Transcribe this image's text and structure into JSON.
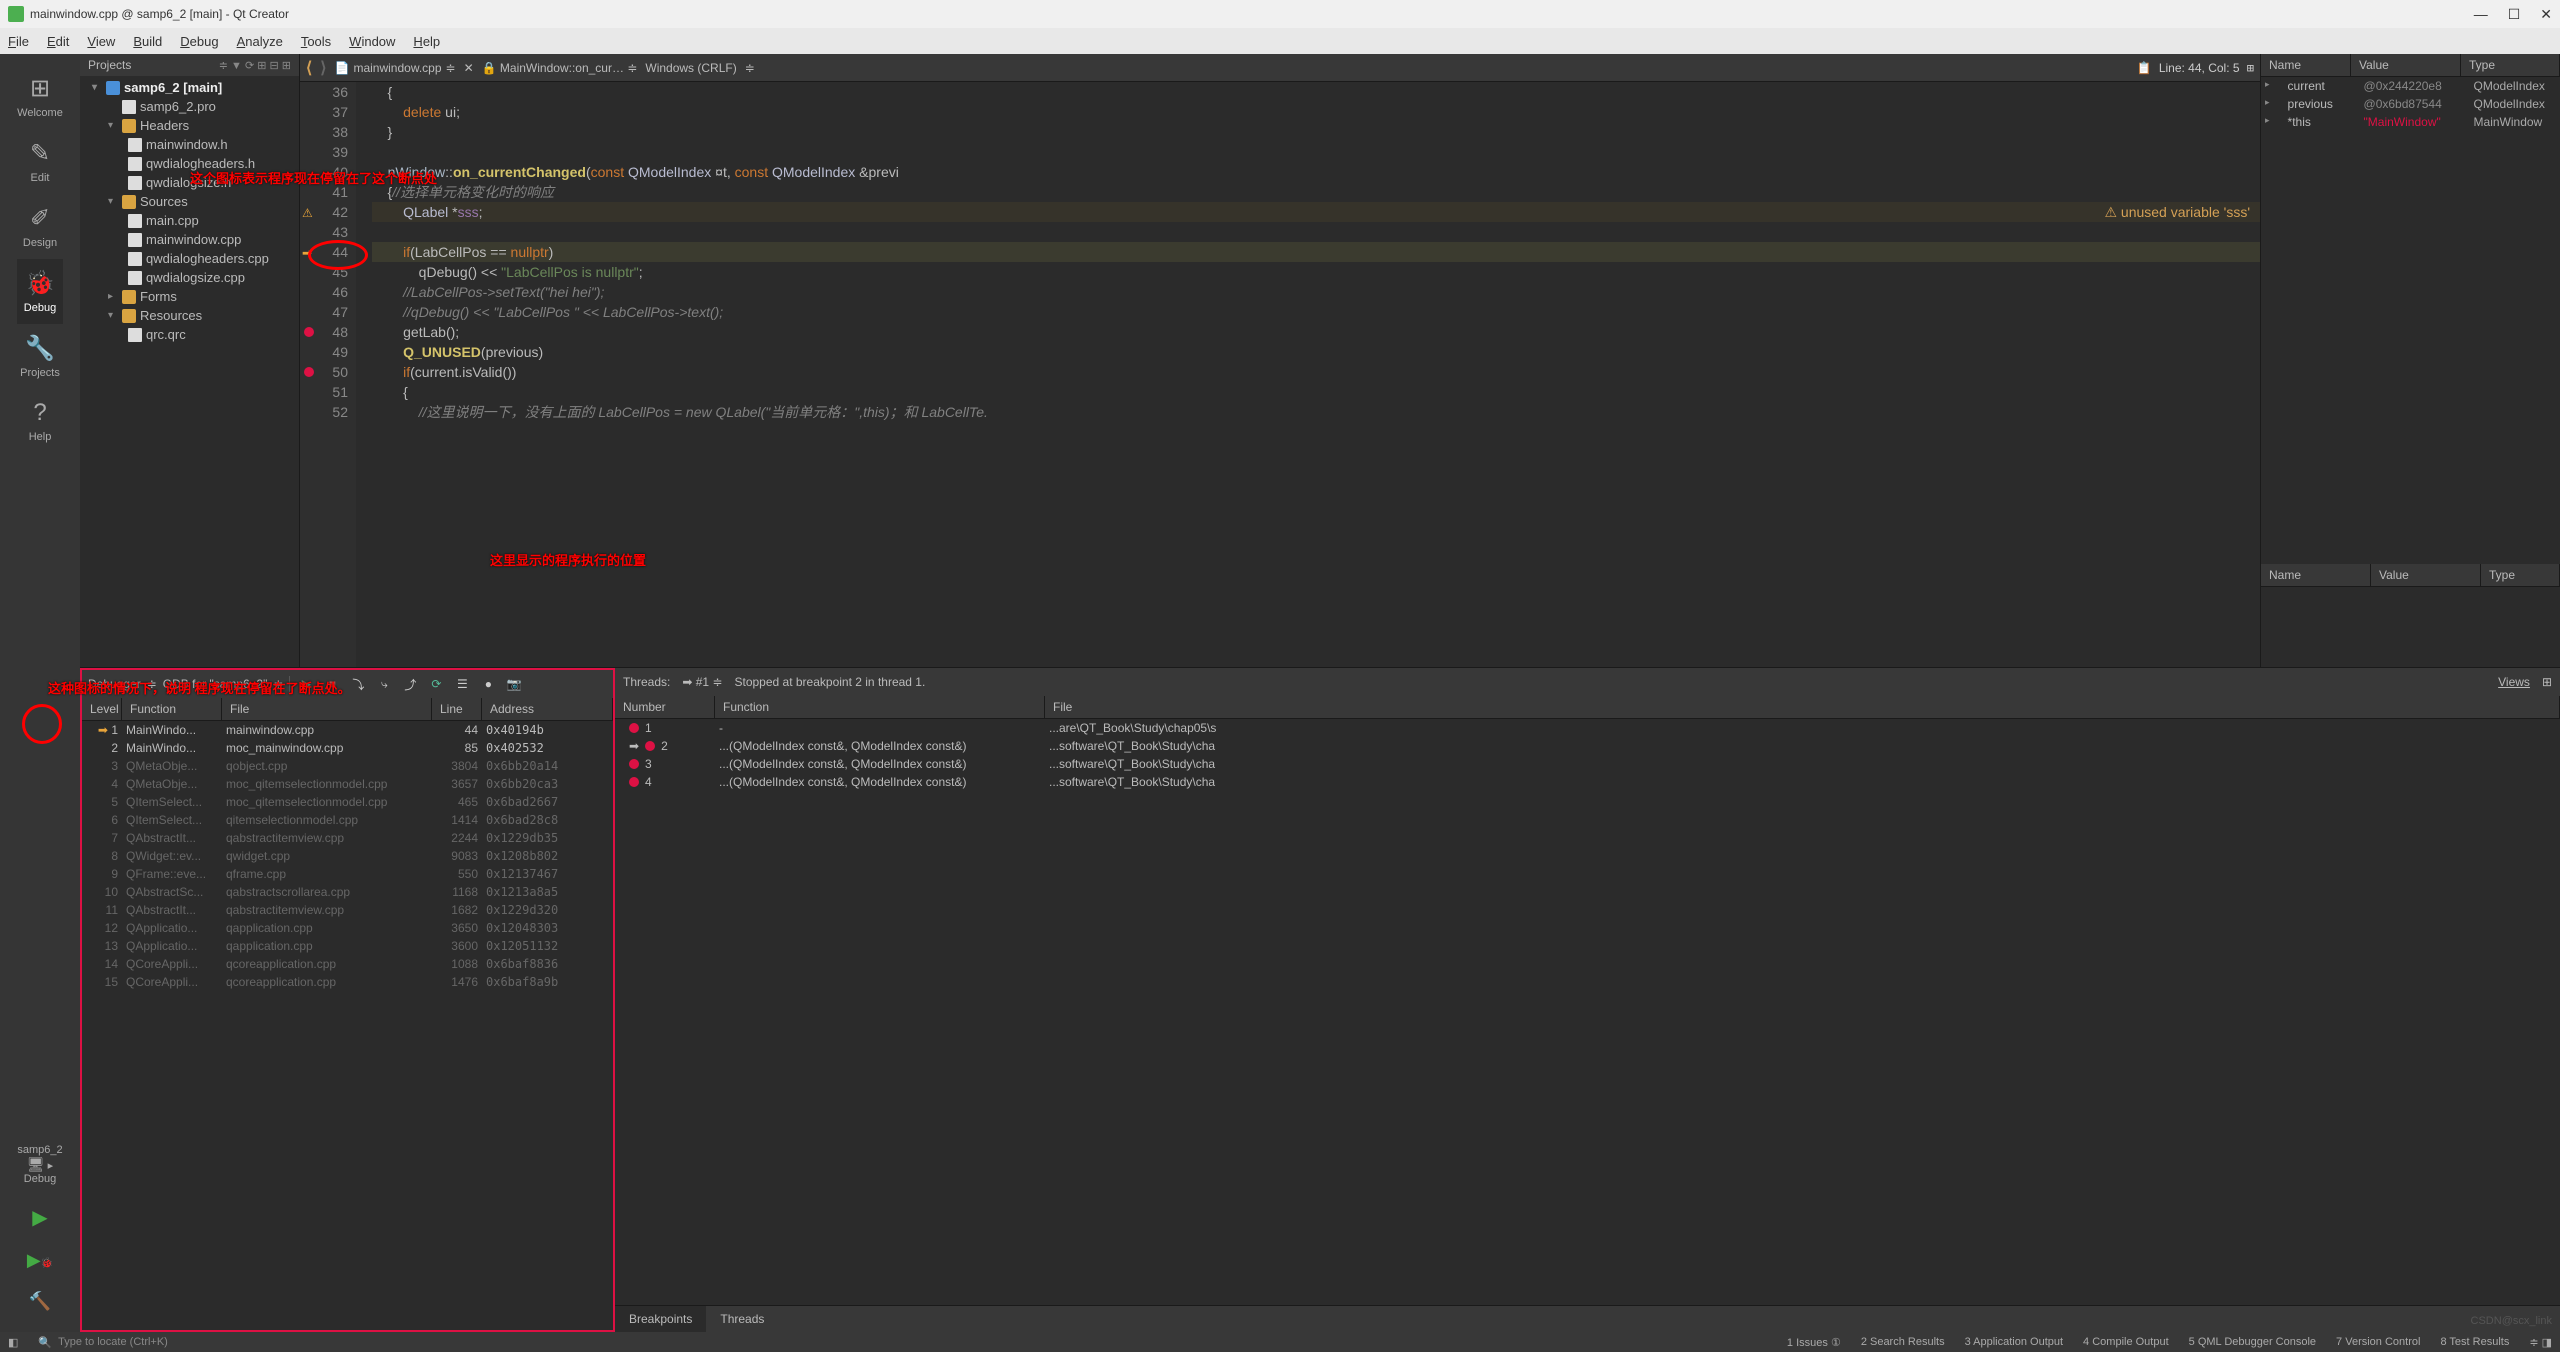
{
  "window": {
    "title": "mainwindow.cpp @ samp6_2 [main] - Qt Creator"
  },
  "menu": [
    "File",
    "Edit",
    "View",
    "Build",
    "Debug",
    "Analyze",
    "Tools",
    "Window",
    "Help"
  ],
  "modes": [
    {
      "label": "Welcome",
      "icon": "⊞"
    },
    {
      "label": "Edit",
      "icon": "✎"
    },
    {
      "label": "Design",
      "icon": "✐"
    },
    {
      "label": "Debug",
      "icon": "🐞",
      "active": true
    },
    {
      "label": "Projects",
      "icon": "🔧"
    },
    {
      "label": "Help",
      "icon": "?"
    }
  ],
  "target": {
    "name": "samp6_2",
    "config": "Debug"
  },
  "projects_title": "Projects",
  "tree": {
    "root": "samp6_2 [main]",
    "pro": "samp6_2.pro",
    "headers": "Headers",
    "h1": "mainwindow.h",
    "h2": "qwdialogheaders.h",
    "h3": "qwdialogsize.h",
    "sources": "Sources",
    "s1": "main.cpp",
    "s2": "mainwindow.cpp",
    "s3": "qwdialogheaders.cpp",
    "s4": "qwdialogsize.cpp",
    "forms": "Forms",
    "resources": "Resources",
    "qrc": "qrc.qrc"
  },
  "editor": {
    "file": "mainwindow.cpp",
    "symbol": "MainWindow::on_cur…",
    "encoding": "Windows (CRLF)",
    "position": "Line: 44, Col: 5",
    "lines": [
      {
        "n": 36,
        "code": "    {"
      },
      {
        "n": 37,
        "code": "        delete ui;",
        "parts": [
          [
            "        ",
            ""
          ],
          [
            "delete",
            "kw"
          ],
          [
            " ui;",
            ""
          ]
        ]
      },
      {
        "n": 38,
        "code": "    }"
      },
      {
        "n": 39,
        "code": ""
      },
      {
        "n": 40,
        "parts": [
          [
            "    ",
            ""
          ],
          [
            "nWindow",
            "cls"
          ],
          [
            "::",
            ""
          ],
          [
            "on_currentChanged",
            "fn"
          ],
          [
            "(",
            ""
          ],
          [
            "const",
            "kw"
          ],
          [
            " ",
            ""
          ],
          [
            "QModelIndex",
            "type"
          ],
          [
            " &current, ",
            ""
          ],
          [
            "const",
            "kw"
          ],
          [
            " ",
            ""
          ],
          [
            "QModelIndex",
            "type"
          ],
          [
            " &previ",
            ""
          ]
        ]
      },
      {
        "n": 41,
        "parts": [
          [
            "    {",
            ""
          ],
          [
            "//选择单元格变化时的响应",
            "cmt"
          ]
        ]
      },
      {
        "n": 42,
        "bp": "warn",
        "warn": "unused variable 'sss'",
        "cls": "warn-line",
        "parts": [
          [
            "        ",
            ""
          ],
          [
            "QLabel",
            "type"
          ],
          [
            " *",
            ""
          ],
          [
            "sss",
            "ptr"
          ],
          [
            ";",
            ""
          ]
        ]
      },
      {
        "n": 43,
        "code": ""
      },
      {
        "n": 44,
        "bp": "arrow",
        "cls": "cur-line",
        "parts": [
          [
            "        ",
            ""
          ],
          [
            "if",
            "kw"
          ],
          [
            "(LabCellPos == ",
            ""
          ],
          [
            "nullptr",
            "kw"
          ],
          [
            ")",
            ""
          ]
        ]
      },
      {
        "n": 45,
        "parts": [
          [
            "            qDebug() << ",
            ""
          ],
          [
            "\"LabCellPos is nullptr\"",
            "str"
          ],
          [
            ";",
            ""
          ]
        ]
      },
      {
        "n": 46,
        "parts": [
          [
            "        ",
            ""
          ],
          [
            "//LabCellPos->setText(\"hei hei\");",
            "cmt"
          ]
        ]
      },
      {
        "n": 47,
        "parts": [
          [
            "        ",
            ""
          ],
          [
            "//qDebug() << \"LabCellPos \" << LabCellPos->text();",
            "cmt"
          ]
        ]
      },
      {
        "n": 48,
        "bp": "red",
        "parts": [
          [
            "        getLab();",
            ""
          ]
        ]
      },
      {
        "n": 49,
        "parts": [
          [
            "        ",
            ""
          ],
          [
            "Q_UNUSED",
            "fn"
          ],
          [
            "(previous)",
            ""
          ]
        ]
      },
      {
        "n": 50,
        "bp": "red",
        "parts": [
          [
            "        ",
            ""
          ],
          [
            "if",
            "kw"
          ],
          [
            "(current.isValid())",
            ""
          ]
        ]
      },
      {
        "n": 51,
        "code": "        {"
      },
      {
        "n": 52,
        "parts": [
          [
            "            ",
            ""
          ],
          [
            "//这里说明一下，没有上面的 LabCellPos = new QLabel(\"当前单元格：\",this)；和 LabCellTe.",
            "cmt"
          ]
        ]
      }
    ]
  },
  "locals": {
    "headers": [
      "Name",
      "Value",
      "Type"
    ],
    "rows": [
      {
        "name": "current",
        "value": "@0x244220e8",
        "type": "QModelIndex"
      },
      {
        "name": "previous",
        "value": "@0x6bd87544",
        "type": "QModelIndex"
      },
      {
        "name": "*this",
        "value": "\"MainWindow\"",
        "type": "MainWindow",
        "red": true
      }
    ]
  },
  "debugger": {
    "label": "Debugger",
    "target": "GDB for \"samp6_2\"",
    "stack_headers": [
      "Level",
      "Function",
      "File",
      "Line",
      "Address"
    ],
    "stack": [
      {
        "lv": "1",
        "fn": "MainWindo...",
        "fl": "mainwindow.cpp",
        "ln": "44",
        "ad": "0x40194b",
        "cur": true
      },
      {
        "lv": "2",
        "fn": "MainWindo...",
        "fl": "moc_mainwindow.cpp",
        "ln": "85",
        "ad": "0x402532"
      },
      {
        "lv": "3",
        "fn": "QMetaObje...",
        "fl": "qobject.cpp",
        "ln": "3804",
        "ad": "0x6bb20a14",
        "dim": true
      },
      {
        "lv": "4",
        "fn": "QMetaObje...",
        "fl": "moc_qitemselectionmodel.cpp",
        "ln": "3657",
        "ad": "0x6bb20ca3",
        "dim": true
      },
      {
        "lv": "5",
        "fn": "QItemSelect...",
        "fl": "moc_qitemselectionmodel.cpp",
        "ln": "465",
        "ad": "0x6bad2667",
        "dim": true
      },
      {
        "lv": "6",
        "fn": "QItemSelect...",
        "fl": "qitemselectionmodel.cpp",
        "ln": "1414",
        "ad": "0x6bad28c8",
        "dim": true
      },
      {
        "lv": "7",
        "fn": "QAbstractIt...",
        "fl": "qabstractitemview.cpp",
        "ln": "2244",
        "ad": "0x1229db35",
        "dim": true
      },
      {
        "lv": "8",
        "fn": "QWidget::ev...",
        "fl": "qwidget.cpp",
        "ln": "9083",
        "ad": "0x1208b802",
        "dim": true
      },
      {
        "lv": "9",
        "fn": "QFrame::eve...",
        "fl": "qframe.cpp",
        "ln": "550",
        "ad": "0x12137467",
        "dim": true
      },
      {
        "lv": "10",
        "fn": "QAbstractSc...",
        "fl": "qabstractscrollarea.cpp",
        "ln": "1168",
        "ad": "0x1213a8a5",
        "dim": true
      },
      {
        "lv": "11",
        "fn": "QAbstractIt...",
        "fl": "qabstractitemview.cpp",
        "ln": "1682",
        "ad": "0x1229d320",
        "dim": true
      },
      {
        "lv": "12",
        "fn": "QApplicatio...",
        "fl": "qapplication.cpp",
        "ln": "3650",
        "ad": "0x12048303",
        "dim": true
      },
      {
        "lv": "13",
        "fn": "QApplicatio...",
        "fl": "qapplication.cpp",
        "ln": "3600",
        "ad": "0x12051132",
        "dim": true
      },
      {
        "lv": "14",
        "fn": "QCoreAppli...",
        "fl": "qcoreapplication.cpp",
        "ln": "1088",
        "ad": "0x6baf8836",
        "dim": true
      },
      {
        "lv": "15",
        "fn": "QCoreAppli...",
        "fl": "qcoreapplication.cpp",
        "ln": "1476",
        "ad": "0x6baf8a9b",
        "dim": true
      }
    ]
  },
  "threads": {
    "label": "Threads:",
    "current": "#1",
    "status": "Stopped at breakpoint 2 in thread 1.",
    "views": "Views"
  },
  "breakpoints": {
    "headers": [
      "Number",
      "Function",
      "File"
    ],
    "rows": [
      {
        "num": "1",
        "fn": "-",
        "file": "...are\\QT_Book\\Study\\chap05\\s"
      },
      {
        "num": "2",
        "fn": "...(QModelIndex const&, QModelIndex const&)",
        "file": "...software\\QT_Book\\Study\\cha",
        "hit": true
      },
      {
        "num": "3",
        "fn": "...(QModelIndex const&, QModelIndex const&)",
        "file": "...software\\QT_Book\\Study\\cha"
      },
      {
        "num": "4",
        "fn": "...(QModelIndex const&, QModelIndex const&)",
        "file": "...software\\QT_Book\\Study\\cha"
      }
    ],
    "tabs": [
      "Breakpoints",
      "Threads"
    ]
  },
  "status": {
    "locate": "Type to locate (Ctrl+K)",
    "items": [
      "1  Issues ①",
      "2  Search Results",
      "3  Application Output",
      "4  Compile Output",
      "5  QML Debugger Console",
      "7  Version Control",
      "8  Test Results"
    ]
  },
  "annotations": {
    "a1": "这个图标表示程序现在停留在了这个断点处",
    "a2": "这里显示的程序执行的位置",
    "a3": "这种图标的情况下，说明 程序现在停留在了断点处。"
  },
  "watermark": "CSDN@scx_link"
}
